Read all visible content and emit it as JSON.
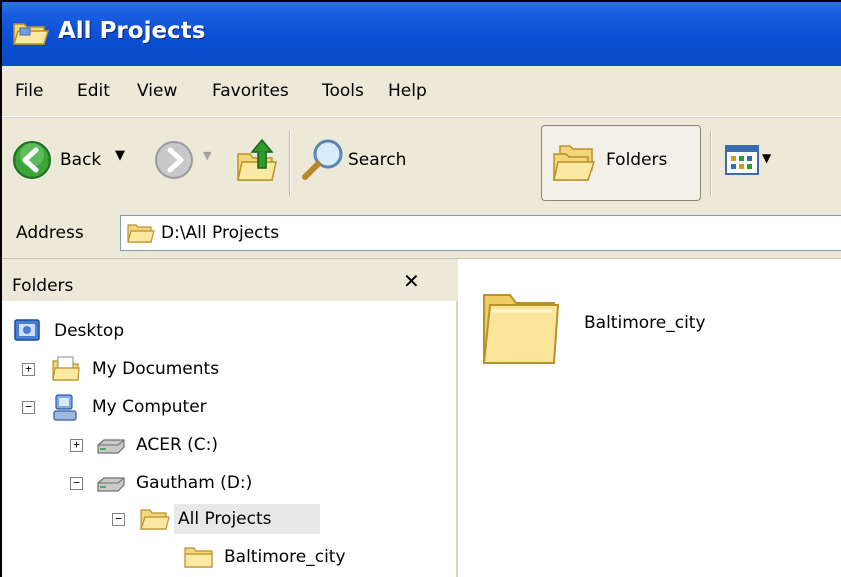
{
  "window": {
    "title": "All Projects",
    "accent_color": "#0a4fd4"
  },
  "menu": {
    "items": [
      "File",
      "Edit",
      "View",
      "Favorites",
      "Tools",
      "Help"
    ]
  },
  "toolbar": {
    "back_label": "Back",
    "search_label": "Search",
    "folders_label": "Folders"
  },
  "address": {
    "label": "Address",
    "value": "D:\\All Projects"
  },
  "folders_pane": {
    "title": "Folders",
    "close_glyph": "✕",
    "tree": [
      {
        "label": "Desktop",
        "icon": "desktop-icon"
      },
      {
        "label": "My Documents",
        "icon": "my-documents-icon",
        "expander": "+"
      },
      {
        "label": "My Computer",
        "icon": "my-computer-icon",
        "expander": "−"
      },
      {
        "label": "ACER (C:)",
        "icon": "drive-icon",
        "expander": "+"
      },
      {
        "label": "Gautham (D:)",
        "icon": "drive-icon",
        "expander": "−"
      },
      {
        "label": "All Projects",
        "icon": "folder-open-icon",
        "expander": "−",
        "selected": true
      },
      {
        "label": "Baltimore_city",
        "icon": "folder-icon"
      }
    ]
  },
  "content": {
    "items": [
      {
        "label": "Baltimore_city",
        "icon": "large-folder-icon"
      }
    ]
  }
}
